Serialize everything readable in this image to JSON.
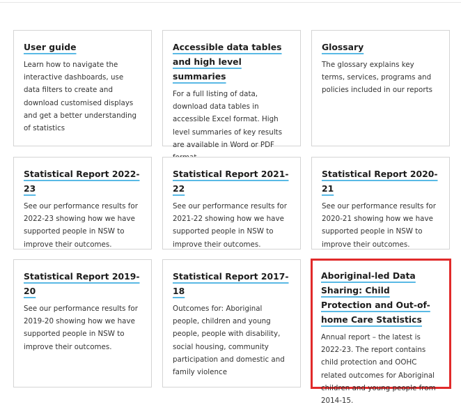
{
  "cards": [
    {
      "title": "User guide",
      "description": "Learn how to navigate the interactive dashboards, use data filters to create and download customised displays and get a better understanding of statistics"
    },
    {
      "title": "Accessible data tables and high level summaries",
      "description": "For a full listing of data, download data tables in accessible Excel format. High level summaries of key results are available in Word or PDF format"
    },
    {
      "title": "Glossary",
      "description": "The glossary explains key terms, services, programs and policies included in our reports"
    },
    {
      "title": "Statistical Report 2022-23",
      "description": "See our performance results for 2022-23 showing how we have supported people in NSW to improve their outcomes."
    },
    {
      "title": "Statistical Report 2021-22",
      "description": "See our performance results for 2021-22 showing how we have supported people in NSW to improve their outcomes."
    },
    {
      "title": "Statistical Report 2020-21",
      "description": "See our performance results for 2020-21 showing how we have supported people in NSW to improve their outcomes."
    },
    {
      "title": "Statistical Report 2019-20",
      "description": "See our performance results for 2019-20 showing how we have supported people in NSW to improve their outcomes."
    },
    {
      "title": "Statistical Report 2017-18",
      "description": "Outcomes for: Aboriginal people, children and young people, people with disability, social housing, community participation and domestic and family violence"
    },
    {
      "title": "Aboriginal-led Data Sharing: Child Protection and Out-of-home Care Statistics",
      "description": "Annual report – the latest is 2022-23. The report contains child protection and OOHC related outcomes for Aboriginal children and young people from 2014-15."
    }
  ],
  "colors": {
    "underline_accent": "#59b9e5",
    "highlight_border": "#e12a2a",
    "card_border": "#d4d4d4"
  }
}
